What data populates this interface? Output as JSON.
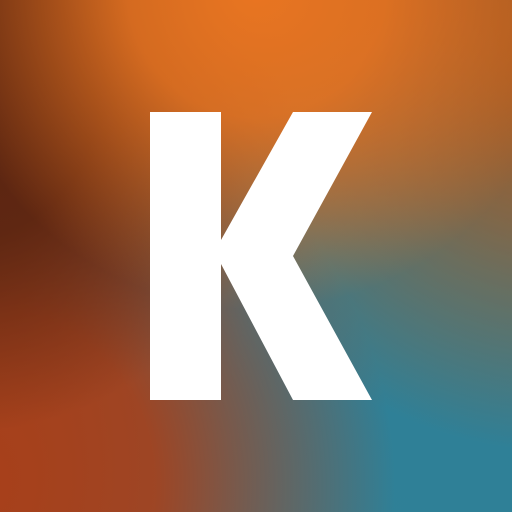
{
  "logo": {
    "letter": "K",
    "letter_color": "#ffffff"
  },
  "colors": {
    "orange": "#e97521",
    "dark_brown": "#5a2410",
    "rust": "#a8401a",
    "teal": "#2f8097"
  }
}
